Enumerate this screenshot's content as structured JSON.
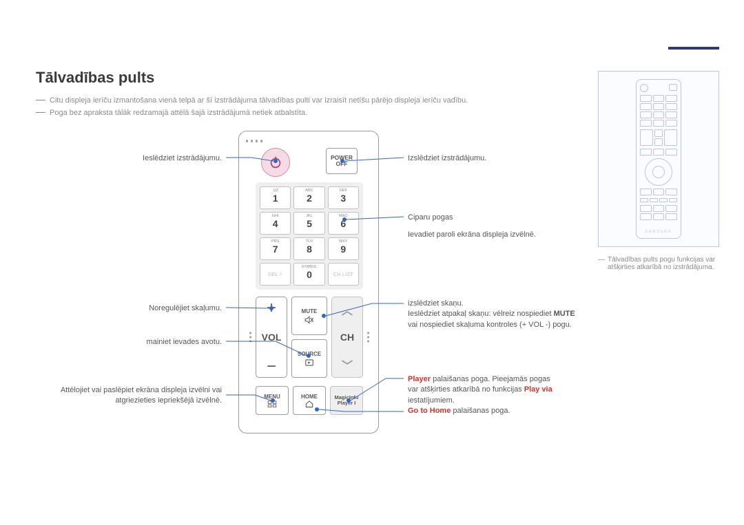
{
  "page": {
    "title": "Tālvadības pults"
  },
  "notes": {
    "n1": "Citu displeja ierīču izmantošana vienā telpā ar šī izstrādājuma tālvadības pulti var izraisīt netīšu pārējo displeja ierīču vadību.",
    "n2": "Poga bez apraksta tālāk redzamajā attēlā šajā izstrādājumā netiek atbalstīta."
  },
  "remote": {
    "power_off": {
      "l1": "POWER",
      "l2": "OFF"
    },
    "keypad": [
      {
        "sub": ".QZ",
        "main": "1"
      },
      {
        "sub": "ABC",
        "main": "2"
      },
      {
        "sub": "DEF",
        "main": "3"
      },
      {
        "sub": "GHI",
        "main": "4"
      },
      {
        "sub": "JKL",
        "main": "5"
      },
      {
        "sub": "MNO",
        "main": "6"
      },
      {
        "sub": "PRS",
        "main": "7"
      },
      {
        "sub": "TUV",
        "main": "8"
      },
      {
        "sub": "WXY",
        "main": "9"
      }
    ],
    "del": "DEL /-",
    "symbol": {
      "sub": "SYMBOL",
      "main": "0"
    },
    "chlist": "CH LIST",
    "vol": {
      "label": "VOL",
      "plus": "+",
      "minus": "−"
    },
    "ch": {
      "label": "CH"
    },
    "mute": "MUTE",
    "source": "SOURCE",
    "menu": "MENU",
    "home": "HOME",
    "magic": {
      "l1": "MagicInfo",
      "l2": "Player I"
    }
  },
  "labels": {
    "left": {
      "l1": "Ieslēdziet izstrādājumu.",
      "l2": "Noregulējiet skaļumu.",
      "l3": "mainiet ievades avotu.",
      "l4a": "Attēlojiet vai paslēpiet ekrāna displeja izvēlni vai",
      "l4b": "atgriezieties iepriekšējā izvēlnē."
    },
    "right": {
      "r1": "Izslēdziet izstrādājumu.",
      "r2a": "Ciparu pogas",
      "r2b": "Ievadiet paroli ekrāna displeja izvēlnē.",
      "r3a": "izslēdziet skaņu.",
      "r3b_pre": "Ieslēdziet atpakaļ skaņu: vēlreiz nospiediet ",
      "r3b_bold": "MUTE",
      "r3c": "vai nospiediet skaļuma kontroles (+ VOL -) pogu.",
      "r4a_hl": "Player",
      "r4a_post": " palaišanas poga. Pieejamās pogas",
      "r4b_pre": "var atšķirties atkarībā no funkcijas ",
      "r4b_hl": "Play via",
      "r4c": "iestatījumiem.",
      "r4d_hl": "Go to Home",
      "r4d_post": " palaišanas poga."
    }
  },
  "side": {
    "note_a": "Tālvadības pults pogu funkcijas var",
    "note_b": "atšķirties atkarībā no izstrādājuma.",
    "brand": "SAMSUNG"
  }
}
